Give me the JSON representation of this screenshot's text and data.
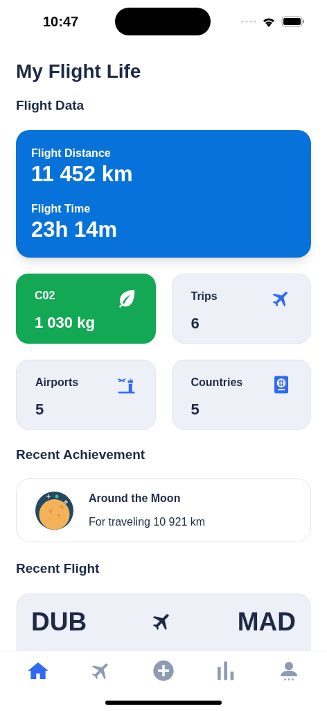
{
  "status_bar": {
    "time": "10:47"
  },
  "title": "My Flight Life",
  "flight_data": {
    "heading": "Flight Data",
    "distance_label": "Flight Distance",
    "distance": "11 452 km",
    "time_label": "Flight Time",
    "time": "23h 14m"
  },
  "stats": [
    {
      "label": "C02",
      "value": "1 030 kg",
      "highlighted": true
    },
    {
      "label": "Trips",
      "value": "6",
      "highlighted": false
    },
    {
      "label": "Airports",
      "value": "5",
      "highlighted": false
    },
    {
      "label": "Countries",
      "value": "5",
      "highlighted": false
    }
  ],
  "achievement": {
    "heading": "Recent Achievement",
    "title": "Around the Moon",
    "subtitle": "For traveling 10 921 km"
  },
  "recent_flight": {
    "heading": "Recent Flight",
    "from": "DUB",
    "to": "MAD"
  },
  "tabs": [
    {
      "selected": true
    },
    {
      "selected": false
    },
    {
      "selected": false
    },
    {
      "selected": false
    },
    {
      "selected": false
    }
  ]
}
